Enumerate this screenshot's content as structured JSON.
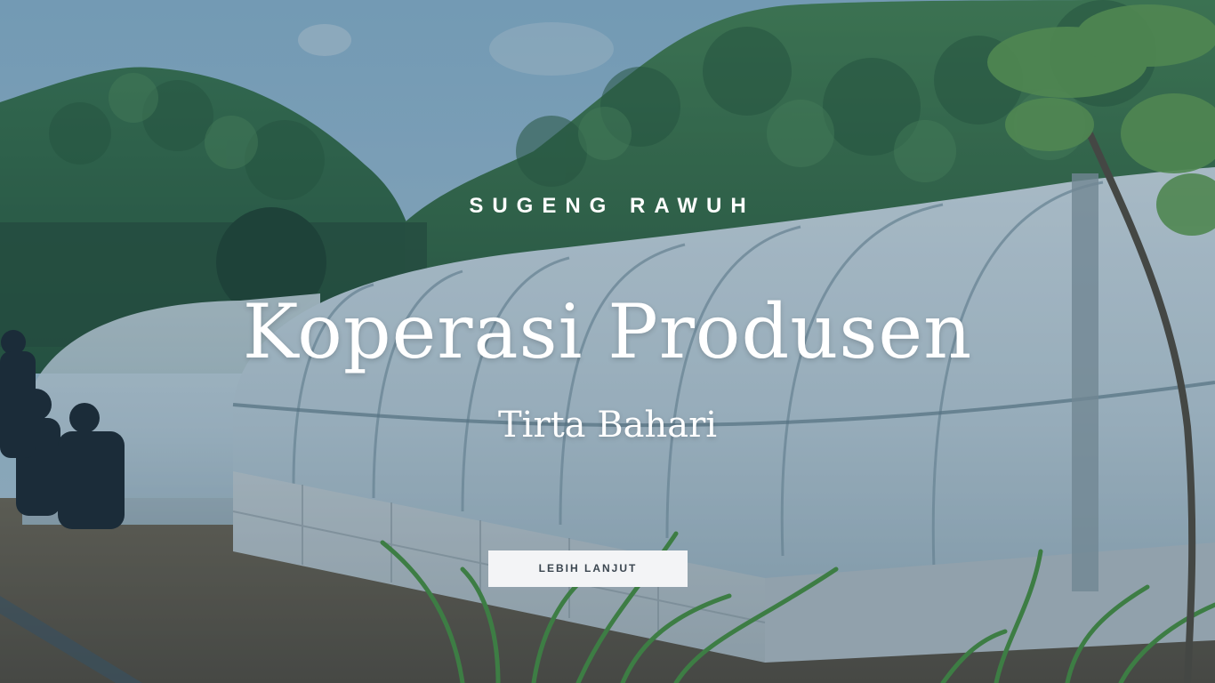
{
  "hero": {
    "eyebrow": "SUGENG RAWUH",
    "title": "Koperasi Produsen",
    "subtitle": "Tirta Bahari",
    "cta_label": "LEBIH LANJUT"
  },
  "colors": {
    "overlay": "#2a5a7a",
    "text": "#ffffff",
    "button_bg": "#f3f4f6",
    "button_text": "#3b4650"
  }
}
